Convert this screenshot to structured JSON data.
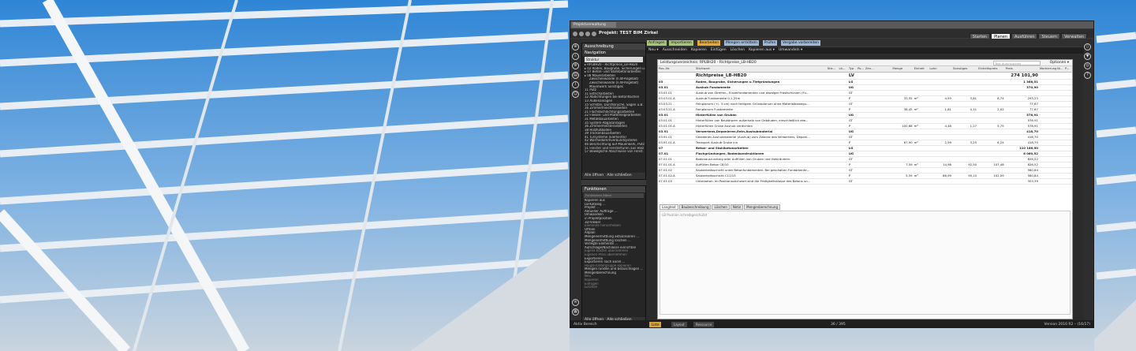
{
  "window": {
    "project_combo": "Projektverwaltung",
    "project_title": "Projekt: TEST BIM Zirkel"
  },
  "ribbon_tabs": [
    {
      "label": "Anfragen",
      "color": "#a8c67a"
    },
    {
      "label": "Importieren",
      "color": "#a8c67a"
    },
    {
      "label": "Bearbeiten",
      "color": "#e6a93a"
    },
    {
      "label": "Mengen ermitteln",
      "color": "#9eb8d8"
    },
    {
      "label": "Prüfen",
      "color": "#9eb8d8"
    },
    {
      "label": "Vergabe vorbereiten",
      "color": "#9eb8d8"
    }
  ],
  "modes": [
    {
      "label": "Starten",
      "active": false
    },
    {
      "label": "Planen",
      "active": true
    },
    {
      "label": "Ausführen",
      "active": false
    },
    {
      "label": "Steuern",
      "active": false
    },
    {
      "label": "Verwalten",
      "active": false
    }
  ],
  "nav": {
    "header": "Ausschreibung",
    "sub": "Navigation",
    "selected": "Struktur",
    "items": [
      "RPLBH20 - Richtpreise_LB-HB20",
      "02 Roden, Baugrube, Sicherungen u.Tiefgr.",
      "07 Beton- und Stahlbetonarbeiten",
      "08 Mauerarbeiten",
      "Zwischenwände (n.W-Angebot)",
      "Zwischenwände (n.W-Angebot)",
      "Mauerwerk Sonstiges",
      "11 Putz",
      "11 Estricharbeiten",
      "12 Abdichtungen bei Betonflächen",
      "13 Außenanlagen",
      "15 Schlitze, Durchbrüche, Sägen u.B.",
      "16 Zimmermeisterarbeiten",
      "21 Flachdachdichtungsarbeiten",
      "22 Fliesen- und Plattenlegearbeiten",
      "31 Metallbauarbeiten",
      "35 System-Abgasanlagen",
      "36 Zimmermeisterarbeiten",
      "38 Holzfußböden",
      "39 Trockenbauarbeiten",
      "41 Türsysteme (Elemente)",
      "42 Wärmedämmverbundsysteme",
      "46 Beschichtung auf Mauerwerk, Putz",
      "51 Fenster und Fenstertüren aus Holz",
      "57 Bewegliche Abschlüsse von Fenst."
    ],
    "open_all": "Alle öffnen",
    "close_all": "Alle schließen"
  },
  "func": {
    "header": "Funktionen",
    "filter": "Funktionen filtern",
    "items": [
      {
        "t": "Kopieren aus",
        "d": false
      },
      {
        "t": "LB-Katalog ...",
        "d": false
      },
      {
        "t": "Projekt ...",
        "d": false
      },
      {
        "t": "Aktueller Auftrage ...",
        "d": false
      },
      {
        "t": "Umwandeln",
        "d": false
      },
      {
        "t": "in Projektposition",
        "d": false
      },
      {
        "t": "3D-Viewer",
        "d": false
      },
      {
        "t": "Elemente hervorheben",
        "d": true
      },
      {
        "t": "Öffnen",
        "d": false
      },
      {
        "t": "Allplan",
        "d": false
      },
      {
        "t": "Mengenermittlung aktualisieren ...",
        "d": false
      },
      {
        "t": "Mengenermittlung löschen ...",
        "d": false
      },
      {
        "t": "Verlegte Elemente ...",
        "d": false
      },
      {
        "t": "Aufschläge/Nachlässe einrichten",
        "d": false
      },
      {
        "t": "Eigene Kosten übernehmen",
        "d": true
      },
      {
        "t": "Eigenen Preis übernehmen",
        "d": true
      },
      {
        "t": "Exportieren",
        "d": false
      },
      {
        "t": "Exportieren nach Excel ...",
        "d": false
      },
      {
        "t": "Haupt-/Untergruppe kopieren",
        "d": true
      },
      {
        "t": "Mengen runden und bezuschlagen ...",
        "d": false
      },
      {
        "t": "Mengenberechnung",
        "d": false
      },
      {
        "t": "Neu",
        "d": true
      },
      {
        "t": "Kopieren",
        "d": true
      },
      {
        "t": "Einfügen",
        "d": true
      },
      {
        "t": "Löschen",
        "d": true
      }
    ],
    "open_all": "Alle öffnen",
    "close_all": "Alle schließen"
  },
  "toolbar": [
    "Neu ▾",
    "Ausschneiden",
    "Kopieren",
    "Einfügen",
    "Löschen",
    "Kopieren aus ▾",
    "Umwandeln ▾"
  ],
  "doc": {
    "title": "Leistungsverzeichnis: RPLBH20 - Richtpreise_LB-HB20",
    "search_placeholder": "Text durchsuchen",
    "options": "Optionen ▾",
    "columns": [
      "Pos.-Nr.",
      "Stichwort",
      "Stic...",
      "Lö...",
      "Typ",
      "Po...",
      "Zen...",
      "",
      "",
      "Menge",
      "Einheit",
      "Lohn",
      "Sonstiges",
      "Einheitspreis",
      "Preis",
      "Markierung...",
      "Ni...",
      "P..."
    ],
    "rows": [
      {
        "k": "big",
        "c": [
          "",
          "Richtpreise_LB-HB20",
          "",
          "",
          "LV",
          "",
          "",
          "",
          "",
          "",
          "",
          "",
          "",
          "",
          "274 101,90",
          "",
          "",
          ""
        ]
      },
      {
        "k": "b",
        "c": [
          "03",
          "Roden, Baugrube, Sicherungen u.Tiefgründungen",
          "",
          "",
          "LG",
          "",
          "",
          "",
          "",
          "",
          "",
          "",
          "",
          "",
          "1 368,51",
          "",
          "",
          ""
        ]
      },
      {
        "k": "b",
        "c": [
          "03.01",
          "Aushub Fundamente",
          "",
          "",
          "UG",
          "",
          "",
          "",
          "",
          "",
          "",
          "",
          "",
          "",
          "370,90",
          "",
          "",
          ""
        ]
      },
      {
        "k": "",
        "c": [
          "03.01.01",
          "Aushub von Streifen-, Einzelfundamenten und etwaiger Frostschürzen (Fu...",
          "",
          "",
          "GT",
          "",
          "",
          "",
          "",
          "",
          "",
          "",
          "",
          "",
          "",
          "",
          "",
          ""
        ]
      },
      {
        "k": "",
        "c": [
          "03.03.01.A",
          "Aushub Fundamente 0-1,25m",
          "",
          "",
          "P",
          "",
          "",
          "",
          "",
          "33,55",
          "m³",
          "4,93",
          "3,81",
          "8,74",
          "293,23",
          "",
          "",
          ""
        ]
      },
      {
        "k": "",
        "c": [
          "03.03.21",
          "Feinplanum (+/- 3 cm) nach fertigem Gründplanum ohne Materialbewegu...",
          "",
          "",
          "GT",
          "",
          "",
          "",
          "",
          "",
          "",
          "",
          "",
          "",
          "77,67",
          "",
          "",
          ""
        ]
      },
      {
        "k": "",
        "c": [
          "03.03.21.A",
          "Feinplanum Fundamente",
          "",
          "",
          "P",
          "",
          "",
          "",
          "",
          "38,45",
          "m²",
          "1,81",
          "0,11",
          "2,02",
          "77,67",
          "",
          "",
          ""
        ]
      },
      {
        "k": "b",
        "c": [
          "03.01",
          "Hinterfüllen von Gruben",
          "",
          "",
          "UG",
          "",
          "",
          "",
          "",
          "",
          "",
          "",
          "",
          "",
          "578,91",
          "",
          "",
          ""
        ]
      },
      {
        "k": "",
        "c": [
          "03.01.01",
          "Hinterfüllen von Baukörpern außerhalb von Gebäuden, einschließlich etw...",
          "",
          "",
          "GT",
          "",
          "",
          "",
          "",
          "",
          "",
          "",
          "",
          "",
          "578,91",
          "",
          "",
          ""
        ]
      },
      {
        "k": "",
        "c": [
          "03.01.01.A",
          "Hinterfüllen Grube Aushub verdichten",
          "",
          "",
          "P",
          "",
          "",
          "",
          "",
          "100,68",
          "m³",
          "4,48",
          "1,27",
          "5,75",
          "578,91",
          "",
          "",
          ""
        ]
      },
      {
        "k": "b",
        "c": [
          "03.91",
          "Verwertens,Deponieren,Entn.Aushubmaterial",
          "",
          "",
          "UG",
          "",
          "",
          "",
          "",
          "",
          "",
          "",
          "",
          "",
          "418,70",
          "",
          "",
          ""
        ]
      },
      {
        "k": "",
        "c": [
          "03.91.01",
          "Geladenes Aushubmaterial (Aushub) zum Zwecke des Verwertens, Deponi...",
          "",
          "",
          "GT",
          "",
          "",
          "",
          "",
          "",
          "",
          "",
          "",
          "",
          "418,70",
          "",
          "",
          ""
        ]
      },
      {
        "k": "",
        "c": [
          "03.91.01.A",
          "Transport Aushub Grube inn",
          "",
          "",
          "P",
          "",
          "",
          "",
          "",
          "67,90",
          "m³",
          "2,99",
          "3,25",
          "6,24",
          "418,70",
          "",
          "",
          ""
        ]
      },
      {
        "k": "b",
        "c": [
          "07",
          "Beton- und Stahlbetonarbeiten",
          "",
          "",
          "LG",
          "",
          "",
          "",
          "",
          "",
          "",
          "",
          "",
          "",
          "110 166,50",
          "",
          "",
          ""
        ]
      },
      {
        "k": "b",
        "c": [
          "07.01",
          "Flachgründungen, Bodenkonstruktionen",
          "",
          "",
          "UG",
          "",
          "",
          "",
          "",
          "",
          "",
          "",
          "",
          "",
          "6 060,52",
          "",
          "",
          ""
        ]
      },
      {
        "k": "",
        "c": [
          "07.01.01",
          "Bodenausrundung oder Auffüllen von Gruben und Hohlräumen.",
          "",
          "",
          "GT",
          "",
          "",
          "",
          "",
          "",
          "",
          "",
          "",
          "",
          "826,52",
          "",
          "",
          ""
        ]
      },
      {
        "k": "",
        "c": [
          "07.01.01.A",
          "Auffüllen Beton C8/10",
          "",
          "",
          "P",
          "",
          "",
          "",
          "",
          "7,59",
          "m³",
          "14,98",
          "92,50",
          "107,48",
          "826,52",
          "",
          "",
          ""
        ]
      },
      {
        "k": "",
        "c": [
          "07.01.02",
          "Sauberkeitsschicht unter Betonfundamenten. Bei geschalten Fundamente...",
          "",
          "",
          "GT",
          "",
          "",
          "",
          "",
          "",
          "",
          "",
          "",
          "",
          "560,84",
          "",
          "",
          ""
        ]
      },
      {
        "k": "",
        "c": [
          "07.01.02.A",
          "Sauberkeitsschicht C12/15",
          "",
          "",
          "P",
          "",
          "",
          "",
          "",
          "5,59",
          "m³",
          "86,99",
          "95,10",
          "102,09",
          "560,84",
          "",
          "",
          ""
        ]
      },
      {
        "k": "",
        "c": [
          "07.01.03",
          "Unterbeton. Im Positionsstichwort sind die Festigkeitsklasse des Betons un...",
          "",
          "",
          "GT",
          "",
          "",
          "",
          "",
          "",
          "",
          "",
          "",
          "",
          "303,39",
          "",
          "",
          ""
        ]
      }
    ],
    "bottom_tabs": [
      "Langtext",
      "Baubeschreibung",
      "Löschen",
      "Notiz",
      "Mengenberechnung"
    ],
    "note_text": "LB Position schreibgeschützt"
  },
  "status": {
    "left": "Aktiv Bereich",
    "tabs": [
      "Liste",
      "Layout",
      "Ressource"
    ],
    "page": "36 / 395",
    "version": "Version 2016 R2 – (16/17)"
  }
}
